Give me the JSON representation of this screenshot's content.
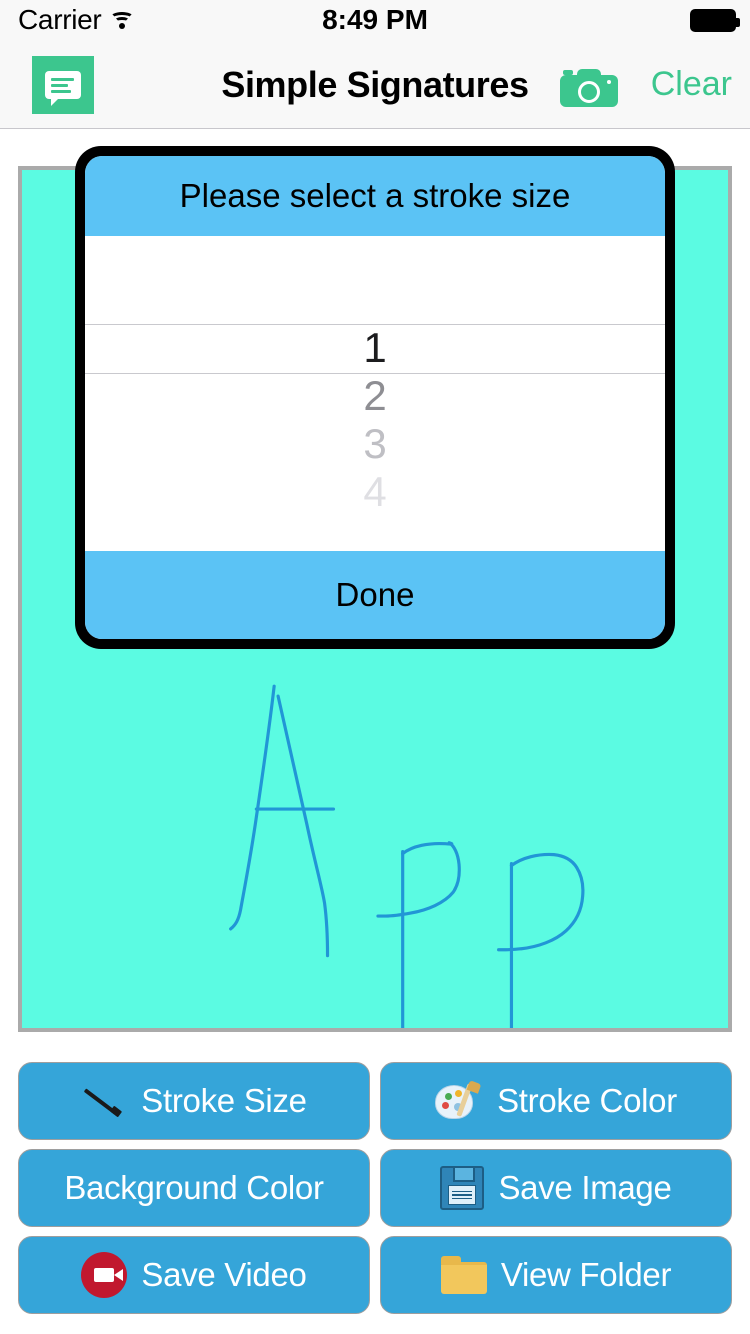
{
  "status_bar": {
    "carrier": "Carrier",
    "wifi_icon": "wifi-icon",
    "time": "8:49 PM",
    "battery_icon": "battery-full-icon"
  },
  "nav_bar": {
    "chat_icon": "chat-bubble-icon",
    "title": "Simple Signatures",
    "camera_icon": "camera-icon",
    "clear_label": "Clear",
    "accent_green": "#3cc68e"
  },
  "canvas": {
    "background_color": "#5bfbe2",
    "border_color": "#aaaaaa",
    "stroke_color": "#2196d6",
    "drawn_text": "APP"
  },
  "modal": {
    "title": "Please select a stroke size",
    "header_color": "#5bc3f5",
    "border_color": "#000000",
    "done_label": "Done",
    "picker": {
      "selected_value": "1",
      "options": [
        "1",
        "2",
        "3",
        "4"
      ]
    }
  },
  "buttons": [
    {
      "label": "Stroke Size",
      "icon": "pen-stroke-icon"
    },
    {
      "label": "Stroke Color",
      "icon": "palette-icon"
    },
    {
      "label": "Background Color",
      "icon": "none"
    },
    {
      "label": "Save Image",
      "icon": "floppy-disk-icon"
    },
    {
      "label": "Save Video",
      "icon": "video-camera-icon"
    },
    {
      "label": "View Folder",
      "icon": "folder-icon"
    }
  ],
  "button_color": "#35a5d9"
}
